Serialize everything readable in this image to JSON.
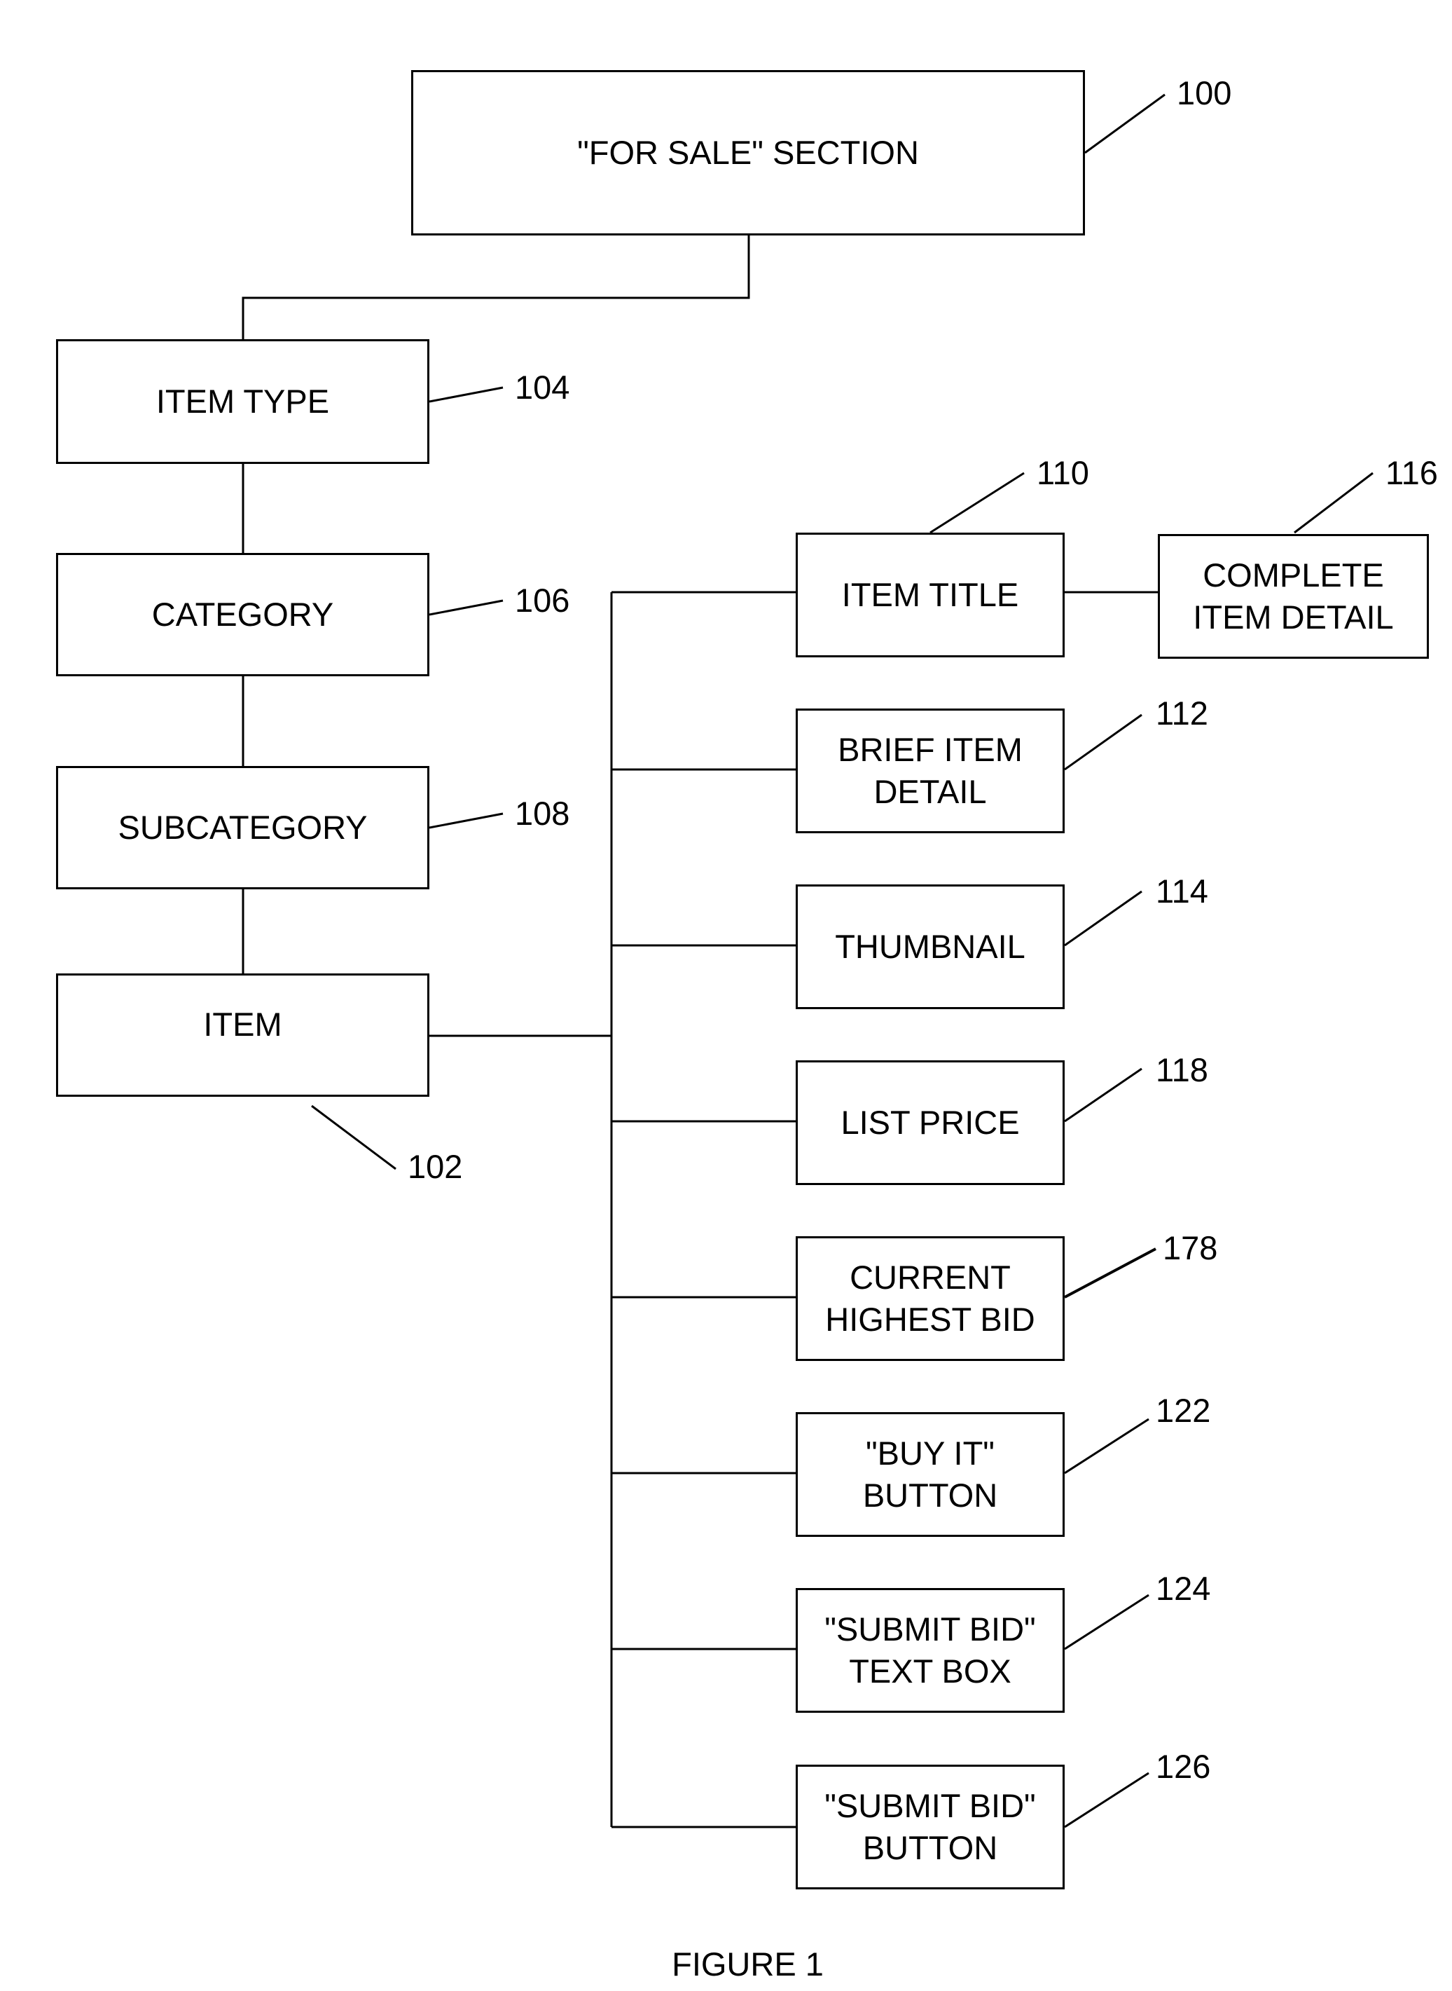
{
  "figure": {
    "caption": "FIGURE 1",
    "nodes": {
      "for_sale": {
        "label": "\"FOR SALE\" SECTION",
        "ref": "100"
      },
      "item_type": {
        "label": "ITEM TYPE",
        "ref": "104"
      },
      "category": {
        "label": "CATEGORY",
        "ref": "106"
      },
      "subcategory": {
        "label": "SUBCATEGORY",
        "ref": "108"
      },
      "item": {
        "label": "ITEM",
        "ref": "102"
      },
      "item_title": {
        "label": "ITEM TITLE",
        "ref": "110"
      },
      "complete_item_detail": {
        "label": "COMPLETE\nITEM DETAIL",
        "ref": "116"
      },
      "brief_item_detail": {
        "label": "BRIEF ITEM\nDETAIL",
        "ref": "112"
      },
      "thumbnail": {
        "label": "THUMBNAIL",
        "ref": "114"
      },
      "list_price": {
        "label": "LIST PRICE",
        "ref": "118"
      },
      "current_highest_bid": {
        "label": "CURRENT\nHIGHEST BID",
        "ref": "178"
      },
      "buy_it_button": {
        "label": "\"BUY IT\"\nBUTTON",
        "ref": "122"
      },
      "submit_bid_text_box": {
        "label": "\"SUBMIT BID\"\nTEXT BOX",
        "ref": "124"
      },
      "submit_bid_button": {
        "label": "\"SUBMIT BID\"\nBUTTON",
        "ref": "126"
      }
    },
    "edges": [
      [
        "for_sale",
        "item_type"
      ],
      [
        "item_type",
        "category"
      ],
      [
        "category",
        "subcategory"
      ],
      [
        "subcategory",
        "item"
      ],
      [
        "item",
        "item_title"
      ],
      [
        "item",
        "brief_item_detail"
      ],
      [
        "item",
        "thumbnail"
      ],
      [
        "item",
        "list_price"
      ],
      [
        "item",
        "current_highest_bid"
      ],
      [
        "item",
        "buy_it_button"
      ],
      [
        "item",
        "submit_bid_text_box"
      ],
      [
        "item",
        "submit_bid_button"
      ],
      [
        "item_title",
        "complete_item_detail"
      ]
    ]
  }
}
